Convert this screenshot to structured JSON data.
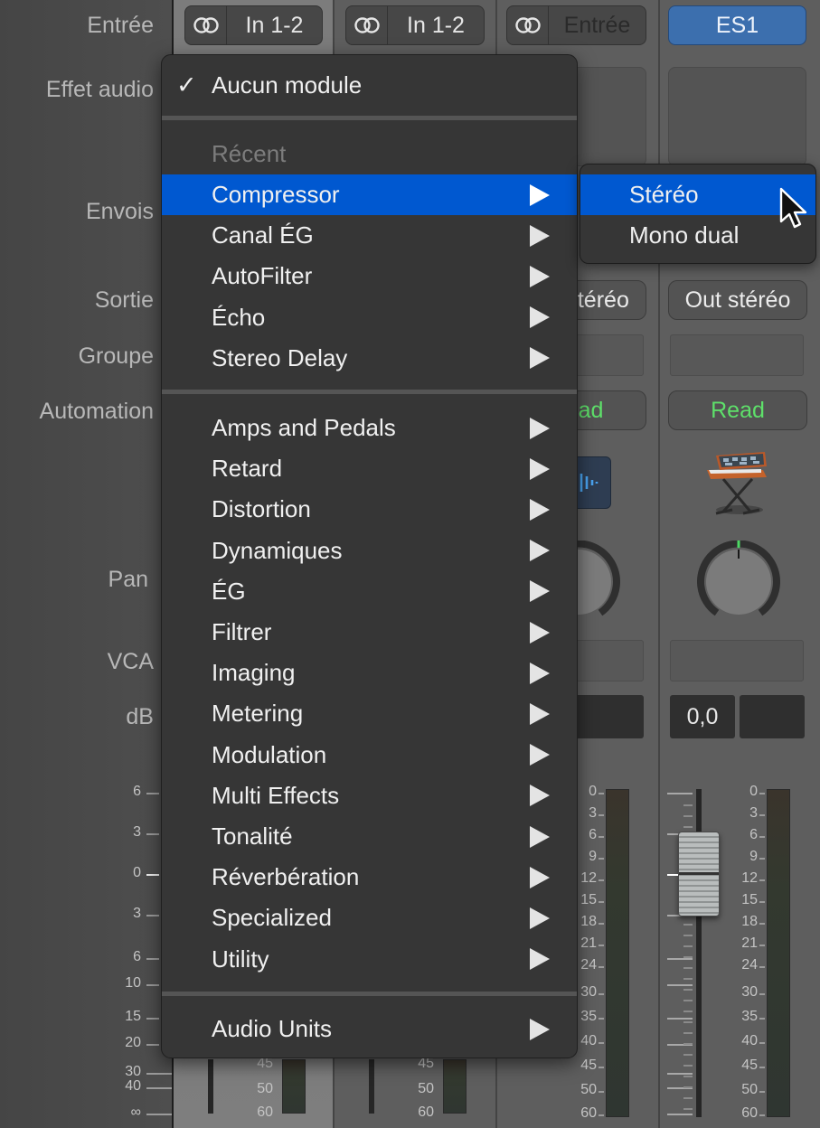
{
  "row_labels": {
    "input": "Entrée",
    "audio_fx": "Effet audio",
    "sends": "Envois",
    "output": "Sortie",
    "group": "Groupe",
    "automation": "Automation",
    "pan": "Pan",
    "vca": "VCA",
    "db": "dB"
  },
  "fader_scale": [
    "6",
    "3",
    "0",
    "3",
    "6",
    "10",
    "15",
    "20",
    "30",
    "40",
    "∞"
  ],
  "meter_scale": [
    "0",
    "3",
    "6",
    "9",
    "12",
    "15",
    "18",
    "21",
    "24",
    "30",
    "35",
    "40",
    "45",
    "50",
    "60"
  ],
  "channels": [
    {
      "input": "In 1-2",
      "input_icon": "stereo-link-icon",
      "selected": true,
      "meter_visible": [
        "45",
        "50",
        "60"
      ]
    },
    {
      "input": "In 1-2",
      "input_icon": "stereo-link-icon",
      "selected": false,
      "meter_visible": [
        "45",
        "50",
        "60"
      ]
    },
    {
      "input": "Entrée",
      "input_icon": "stereo-link-icon",
      "selected": false,
      "output": "Out stéréo",
      "automation": "Read",
      "icon": "audio-waveform-icon"
    },
    {
      "input": "ES1",
      "selected": false,
      "output": "Out stéréo",
      "automation": "Read",
      "icon": "synthesizer-keyboard-icon",
      "pan_value": 0,
      "db_value": "0,0"
    }
  ],
  "menu": {
    "none_item": "Aucun module",
    "none_checked": true,
    "recent_header": "Récent",
    "recent": [
      "Compressor",
      "Canal ÉG",
      "AutoFilter",
      "Écho",
      "Stereo Delay"
    ],
    "highlighted": "Compressor",
    "categories": [
      "Amps and Pedals",
      "Retard",
      "Distortion",
      "Dynamiques",
      "ÉG",
      "Filtrer",
      "Imaging",
      "Metering",
      "Modulation",
      "Multi Effects",
      "Tonalité",
      "Réverbération",
      "Specialized",
      "Utility"
    ],
    "audio_units": "Audio Units"
  },
  "submenu": {
    "items": [
      "Stéréo",
      "Mono dual"
    ],
    "highlighted": "Stéréo"
  },
  "colors": {
    "menu_highlight": "#0058d0",
    "instrument_button": "#3c6fae",
    "automation_read": "#5ee06a"
  }
}
